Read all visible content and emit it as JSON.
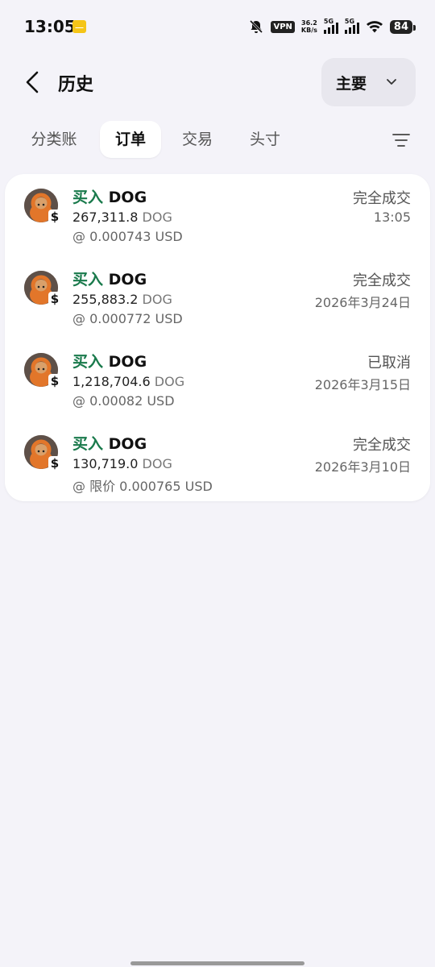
{
  "status_bar": {
    "time": "13:05",
    "vpn": "VPN",
    "speed_value": "36.2",
    "speed_unit": "KB/s",
    "sim1": "5G",
    "sim2": "5G",
    "battery": "84"
  },
  "header": {
    "title": "历史",
    "account_selector": "主要"
  },
  "tabs": [
    {
      "label": "分类账",
      "active": false
    },
    {
      "label": "订单",
      "active": true
    },
    {
      "label": "交易",
      "active": false
    },
    {
      "label": "头寸",
      "active": false
    }
  ],
  "orders": [
    {
      "side": "买入",
      "symbol": "DOG",
      "amount": "267,311.8",
      "unit": "DOG",
      "price": "@ 0.000743 USD",
      "status": "完全成交",
      "date": "13:05"
    },
    {
      "side": "买入",
      "symbol": "DOG",
      "amount": "255,883.2",
      "unit": "DOG",
      "price": "@ 0.000772 USD",
      "status": "完全成交",
      "date": "2026年3月24日"
    },
    {
      "side": "买入",
      "symbol": "DOG",
      "amount": "1,218,704.6",
      "unit": "DOG",
      "price": "@ 0.00082 USD",
      "status": "已取消",
      "date": "2026年3月15日"
    },
    {
      "side": "买入",
      "symbol": "DOG",
      "amount": "130,719.0",
      "unit": "DOG",
      "price": "@ 限价 0.000765 USD",
      "status": "完全成交",
      "date": "2026年3月10日"
    }
  ],
  "colors": {
    "buy": "#1a7a4c",
    "background": "#f4f3f9",
    "card": "#ffffff"
  }
}
